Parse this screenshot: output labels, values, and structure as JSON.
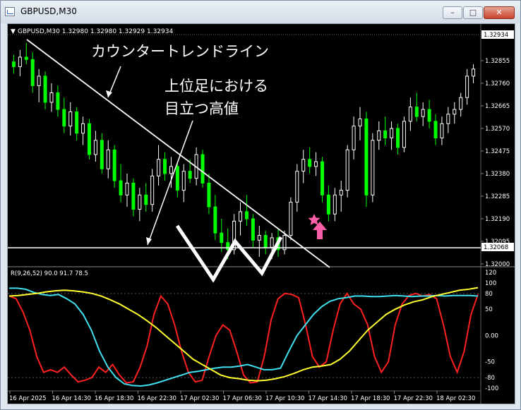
{
  "window": {
    "title": "GBPUSD,M30",
    "buttons": {
      "minimize": "–",
      "maximize": "□",
      "close": "✕"
    }
  },
  "chart": {
    "header": "GBPUSD,M30  1.32980 1.32980 1.32929 1.32934",
    "symbol": "GBPUSD",
    "timeframe": "M30",
    "price_labels": [
      "1.32855",
      "1.32760",
      "1.32665",
      "1.32570",
      "1.32475",
      "1.32380",
      "1.32285",
      "1.32190",
      "1.32095",
      "1.32000"
    ],
    "current_price_label": "1.32934",
    "horizontal_line_label": "1.32068",
    "time_labels": [
      "16 Apr 2025",
      "16 Apr 14:30",
      "16 Apr 18:30",
      "16 Apr 22:30",
      "17 Apr 02:30",
      "17 Apr 06:30",
      "17 Apr 10:30",
      "17 Apr 14:30",
      "17 Apr 18:30",
      "17 Apr 22:30",
      "18 Apr 02:30"
    ],
    "colors": {
      "background": "#000000",
      "bull_candle": "#ffffff",
      "bear_candle": "#00ff00",
      "trendline": "#ffffff",
      "marker_star": "#ff5fa8",
      "marker_arrow": "#ff5fa8"
    }
  },
  "annotations": {
    "trendline_label": "カウンタートレンドライン",
    "high_label_line1": "上位足における",
    "high_label_line2": "目立つ高値"
  },
  "indicator": {
    "header": "R(9,26,52) 90.0 91.7 78.5",
    "scale_labels": [
      "120",
      "100",
      "80",
      "50",
      "0.00",
      "-50",
      "-80",
      "-100"
    ],
    "colors": {
      "fast": "#ff2020",
      "mid": "#40e0f0",
      "slow": "#ffff30"
    }
  },
  "chart_data": {
    "type": "line",
    "title": "",
    "xlabel": "",
    "ylabel": "",
    "price_range": [
      1.32,
      1.3295
    ],
    "candles": [
      [
        1.3285,
        1.3288,
        1.328,
        1.3283
      ],
      [
        1.3283,
        1.329,
        1.3279,
        1.3287
      ],
      [
        1.3287,
        1.3293,
        1.3284,
        1.3286
      ],
      [
        1.3286,
        1.3289,
        1.3272,
        1.3275
      ],
      [
        1.3275,
        1.3282,
        1.3268,
        1.3279
      ],
      [
        1.3279,
        1.3281,
        1.3265,
        1.3268
      ],
      [
        1.3268,
        1.3276,
        1.3264,
        1.3272
      ],
      [
        1.3272,
        1.3275,
        1.3262,
        1.3265
      ],
      [
        1.3265,
        1.327,
        1.3255,
        1.3258
      ],
      [
        1.3258,
        1.3268,
        1.3254,
        1.3264
      ],
      [
        1.3264,
        1.3266,
        1.3252,
        1.3255
      ],
      [
        1.3255,
        1.3262,
        1.325,
        1.3259
      ],
      [
        1.3259,
        1.3261,
        1.3244,
        1.3246
      ],
      [
        1.3246,
        1.3256,
        1.3243,
        1.3252
      ],
      [
        1.3252,
        1.3255,
        1.3238,
        1.324
      ],
      [
        1.324,
        1.3252,
        1.3236,
        1.3248
      ],
      [
        1.3248,
        1.325,
        1.3232,
        1.3235
      ],
      [
        1.3235,
        1.3242,
        1.3226,
        1.3229
      ],
      [
        1.3229,
        1.3238,
        1.3224,
        1.3234
      ],
      [
        1.3234,
        1.3236,
        1.322,
        1.3223
      ],
      [
        1.3223,
        1.3232,
        1.3218,
        1.3229
      ],
      [
        1.3229,
        1.3234,
        1.3222,
        1.3225
      ],
      [
        1.3225,
        1.324,
        1.3222,
        1.3237
      ],
      [
        1.3237,
        1.325,
        1.3233,
        1.3244
      ],
      [
        1.3244,
        1.3247,
        1.3235,
        1.3238
      ],
      [
        1.3238,
        1.3245,
        1.3232,
        1.3241
      ],
      [
        1.3241,
        1.3243,
        1.3228,
        1.3231
      ],
      [
        1.3231,
        1.3242,
        1.3226,
        1.3239
      ],
      [
        1.3239,
        1.3244,
        1.3234,
        1.3236
      ],
      [
        1.3236,
        1.3249,
        1.3233,
        1.3246
      ],
      [
        1.3246,
        1.3248,
        1.3232,
        1.3234
      ],
      [
        1.3234,
        1.3238,
        1.3221,
        1.3224
      ],
      [
        1.3224,
        1.3229,
        1.321,
        1.3213
      ],
      [
        1.3213,
        1.3219,
        1.3205,
        1.3209
      ],
      [
        1.3209,
        1.3215,
        1.3202,
        1.3206
      ],
      [
        1.3206,
        1.3221,
        1.3204,
        1.3218
      ],
      [
        1.3218,
        1.3226,
        1.3212,
        1.3222
      ],
      [
        1.3222,
        1.3229,
        1.3216,
        1.3219
      ],
      [
        1.3219,
        1.3221,
        1.3207,
        1.321
      ],
      [
        1.321,
        1.3216,
        1.3203,
        1.3212
      ],
      [
        1.3212,
        1.3214,
        1.3204,
        1.3207
      ],
      [
        1.3207,
        1.3213,
        1.3202,
        1.3211
      ],
      [
        1.3211,
        1.3215,
        1.3203,
        1.3206
      ],
      [
        1.3206,
        1.3214,
        1.3204,
        1.3212
      ],
      [
        1.3212,
        1.3228,
        1.321,
        1.3226
      ],
      [
        1.3226,
        1.3242,
        1.3222,
        1.3239
      ],
      [
        1.3239,
        1.3248,
        1.3234,
        1.3244
      ],
      [
        1.3244,
        1.3249,
        1.3238,
        1.3241
      ],
      [
        1.3241,
        1.3247,
        1.3237,
        1.3243
      ],
      [
        1.3243,
        1.3245,
        1.3226,
        1.3229
      ],
      [
        1.3229,
        1.3233,
        1.3218,
        1.3221
      ],
      [
        1.3221,
        1.3232,
        1.3218,
        1.3229
      ],
      [
        1.3229,
        1.3235,
        1.3222,
        1.3231
      ],
      [
        1.3231,
        1.325,
        1.3228,
        1.3248
      ],
      [
        1.3248,
        1.3262,
        1.3244,
        1.3258
      ],
      [
        1.3258,
        1.3266,
        1.3252,
        1.3261
      ],
      [
        1.3261,
        1.3264,
        1.3224,
        1.3229
      ],
      [
        1.3229,
        1.3255,
        1.3226,
        1.3252
      ],
      [
        1.3252,
        1.326,
        1.3248,
        1.3256
      ],
      [
        1.3256,
        1.3262,
        1.325,
        1.3253
      ],
      [
        1.3253,
        1.326,
        1.3248,
        1.3257
      ],
      [
        1.3257,
        1.3259,
        1.3246,
        1.3249
      ],
      [
        1.3249,
        1.3262,
        1.3247,
        1.326
      ],
      [
        1.326,
        1.327,
        1.3256,
        1.3266
      ],
      [
        1.3266,
        1.3272,
        1.326,
        1.3262
      ],
      [
        1.3262,
        1.3268,
        1.3258,
        1.3265
      ],
      [
        1.3265,
        1.3269,
        1.3257,
        1.326
      ],
      [
        1.326,
        1.3263,
        1.325,
        1.3253
      ],
      [
        1.3253,
        1.3262,
        1.325,
        1.3259
      ],
      [
        1.3259,
        1.3266,
        1.3255,
        1.3263
      ],
      [
        1.3263,
        1.3268,
        1.3259,
        1.3265
      ],
      [
        1.3265,
        1.3272,
        1.3262,
        1.327
      ],
      [
        1.327,
        1.3282,
        1.3267,
        1.3279
      ],
      [
        1.3279,
        1.3284,
        1.3276,
        1.3282
      ]
    ],
    "horizontal_line": 1.32068,
    "indicator_range": [
      -100,
      120
    ],
    "series": [
      {
        "name": "fast",
        "values": [
          75,
          70,
          45,
          10,
          -40,
          -70,
          -65,
          -70,
          -60,
          -75,
          -88,
          -85,
          -80,
          -60,
          -70,
          -55,
          -75,
          -90,
          -88,
          -60,
          -20,
          40,
          75,
          60,
          20,
          -30,
          -70,
          -88,
          -85,
          -40,
          0,
          20,
          10,
          -30,
          -75,
          -90,
          -88,
          -40,
          30,
          70,
          80,
          78,
          72,
          20,
          -40,
          -60,
          -50,
          10,
          60,
          80,
          60,
          50,
          20,
          -40,
          -70,
          -50,
          20,
          60,
          76,
          80,
          75,
          78,
          70,
          20,
          -40,
          -70,
          -30,
          40,
          78
        ]
      },
      {
        "name": "mid",
        "values": [
          90,
          90,
          88,
          82,
          78,
          76,
          78,
          70,
          60,
          40,
          10,
          -30,
          -60,
          -80,
          -92,
          -95,
          -96,
          -94,
          -90,
          -85,
          -80,
          -75,
          -70,
          -68,
          -65,
          -62,
          -60,
          -60,
          -58,
          -55,
          -60,
          -65,
          -65,
          -62,
          -30,
          0,
          20,
          40,
          55,
          65,
          70,
          72,
          75,
          75,
          74,
          74,
          75,
          76,
          75,
          74,
          75,
          75,
          76,
          75,
          76,
          76,
          76,
          75
        ]
      },
      {
        "name": "slow",
        "values": [
          75,
          76,
          78,
          80,
          83,
          85,
          86,
          85,
          83,
          80,
          75,
          68,
          60,
          50,
          40,
          28,
          15,
          0,
          -15,
          -30,
          -45,
          -55,
          -65,
          -75,
          -80,
          -82,
          -85,
          -86,
          -85,
          -82,
          -78,
          -72,
          -65,
          -60,
          -58,
          -55,
          -45,
          -30,
          -10,
          10,
          25,
          40,
          50,
          58,
          64,
          68,
          74,
          78,
          82,
          86,
          88,
          91
        ]
      }
    ]
  }
}
